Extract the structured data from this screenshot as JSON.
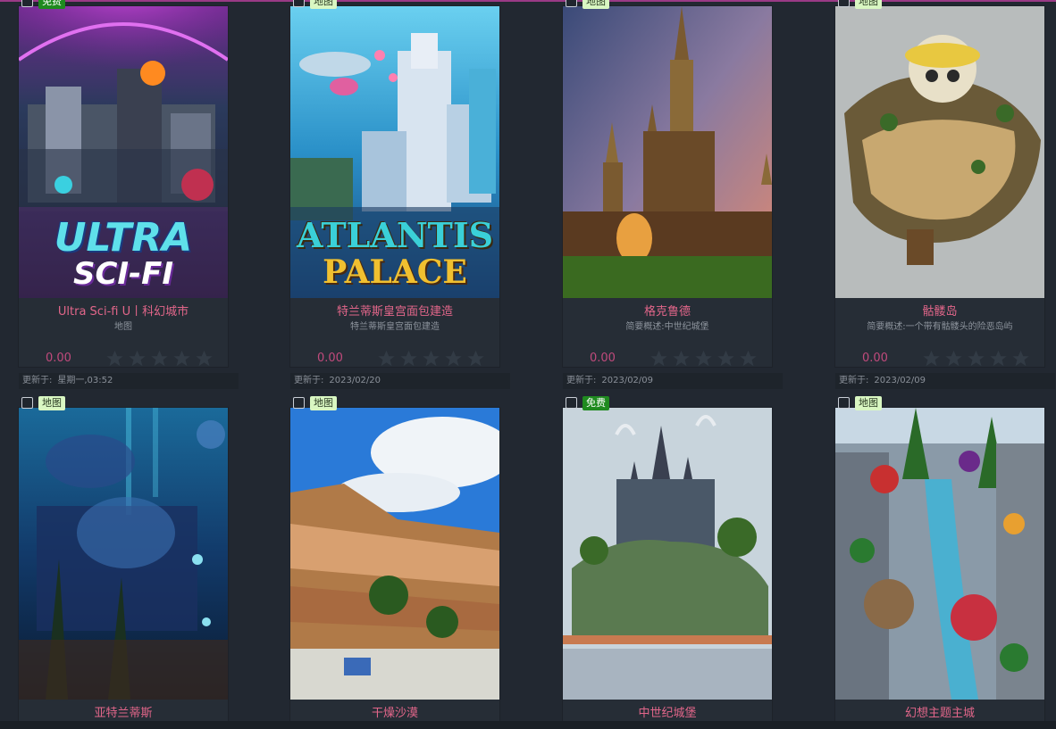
{
  "tags": {
    "map": "地图",
    "free": "免费"
  },
  "updated_label": "更新于:",
  "cards": [
    {
      "title": "Ultra Sci-fi U丨科幻城市",
      "subtitle": "地图",
      "price": "0.00",
      "updated": "星期一,03:52",
      "tag": "免费",
      "thumb_logo_1": "ULTRA",
      "thumb_logo_2": "SCI-FI"
    },
    {
      "title": "特兰蒂斯皇宫面包建造",
      "subtitle": "特兰蒂斯皇宫面包建造",
      "price": "0.00",
      "updated": "2023/02/20",
      "tag": "地图",
      "thumb_logo_1": "ATLANTIS",
      "thumb_logo_2": "PALACE"
    },
    {
      "title": "格克鲁德",
      "subtitle": "简要概述:中世纪城堡",
      "price": "0.00",
      "updated": "2023/02/09",
      "tag": "地图"
    },
    {
      "title": "骷髅岛",
      "subtitle": "简要概述:一个带有骷髅头的险恶岛屿",
      "price": "0.00",
      "updated": "2023/02/09",
      "tag": "地图"
    },
    {
      "title": "亚特兰蒂斯",
      "tag": "地图"
    },
    {
      "title": "干燥沙漠",
      "tag": "地图"
    },
    {
      "title": "中世纪城堡",
      "tag": "免费"
    },
    {
      "title": "幻想主题主城",
      "tag": "地图"
    }
  ],
  "colors": {
    "background": "#222831",
    "title": "#e2668a",
    "price": "#c04a7c",
    "accent_line": "#9a3a86"
  }
}
